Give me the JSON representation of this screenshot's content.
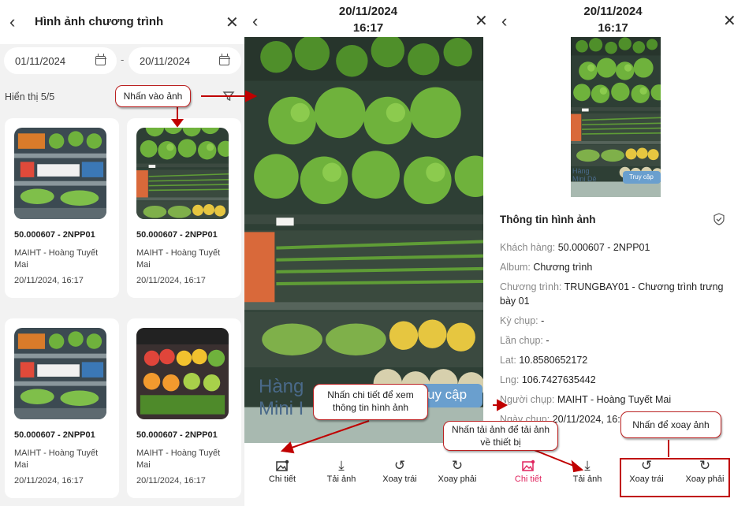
{
  "left_panel": {
    "title": "Hình ảnh chương trình",
    "from_date": "01/11/2024",
    "to_date": "20/11/2024",
    "date_separator": "-",
    "count_label": "Hiển thị 5/5",
    "cards": [
      {
        "code": "50.000607 - 2NPP01",
        "user": "MAIHT - Hoàng Tuyết Mai",
        "time": "20/11/2024, 16:17"
      },
      {
        "code": "50.000607 - 2NPP01",
        "user": "MAIHT - Hoàng Tuyết Mai",
        "time": "20/11/2024, 16:17"
      },
      {
        "code": "50.000607 - 2NPP01",
        "user": "MAIHT - Hoàng Tuyết Mai",
        "time": "20/11/2024, 16:17"
      },
      {
        "code": "50.000607 - 2NPP01",
        "user": "MAIHT - Hoàng Tuyết Mai",
        "time": "20/11/2024, 16:17"
      }
    ]
  },
  "viewer": {
    "date": "20/11/2024",
    "time": "16:17",
    "photo_sign": [
      "Hàng",
      "Mini I"
    ],
    "photo_tag": "uy cập",
    "actions": [
      "Chi tiết",
      "Tải ảnh",
      "Xoay trái",
      "Xoay phải"
    ]
  },
  "detail": {
    "date": "20/11/2024",
    "time": "16:17",
    "photo_sign": [
      "Hàng",
      "Mini Dê"
    ],
    "photo_tag": "Truy cập",
    "info_title": "Thông tin hình ảnh",
    "fields": {
      "customer_key": "Khách hàng:",
      "customer_val": "50.000607 - 2NPP01",
      "album_key": "Album:",
      "album_val": "Chương trình",
      "program_key": "Chương trình:",
      "program_val": "TRUNGBAY01 - Chương trình trưng bày 01",
      "period_key": "Kỳ chụp:",
      "period_val": "-",
      "count_key": "Lần chụp:",
      "count_val": "-",
      "lat_key": "Lat:",
      "lat_val": "10.8580652172",
      "lng_key": "Lng:",
      "lng_val": "106.7427635442",
      "user_key": "Người chụp:",
      "user_val": "MAIHT - Hoàng Tuyết Mai",
      "date_key": "Ngày chụp:",
      "date_val": "20/11/2024, 16:17"
    },
    "actions": [
      "Chi tiết",
      "Tải ảnh",
      "Xoay trái",
      "Xoay phải"
    ]
  },
  "callouts": {
    "tap_photo": "Nhấn vào ảnh",
    "detail": "Nhấn chi tiết để xem thông tin hình ảnh",
    "download": "Nhấn tải ảnh để tải ảnh về thiết bị",
    "rotate": "Nhấn để xoay ảnh"
  },
  "colors": {
    "accent_active": "#e0245e",
    "annotation": "#c00000",
    "produce_green": "#4f8f2a"
  }
}
